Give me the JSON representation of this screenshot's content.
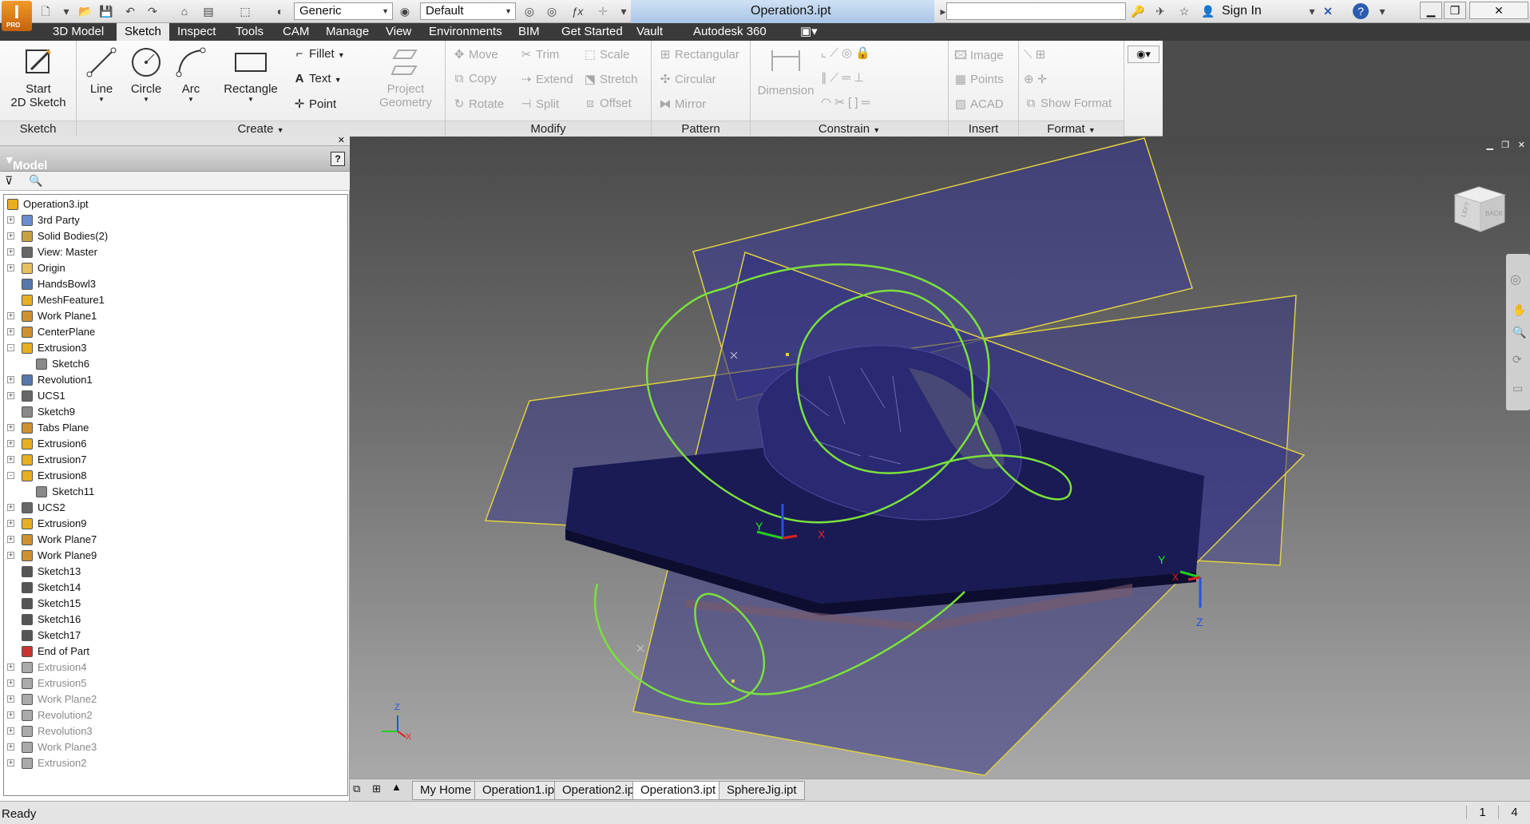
{
  "app": {
    "logo": "I",
    "edition": "PRO"
  },
  "titlebar": {
    "material_combo": "Generic",
    "appearance_combo": "Default",
    "document_title": "Operation3.ipt",
    "sign_in": "Sign In"
  },
  "tabs": [
    "3D Model",
    "Sketch",
    "Inspect",
    "Tools",
    "CAM",
    "Manage",
    "View",
    "Environments",
    "BIM",
    "Get Started",
    "Vault",
    "Autodesk 360"
  ],
  "active_tab": "Sketch",
  "ribbon": {
    "sketch_panel": {
      "name": "Sketch",
      "start": "Start",
      "start2": "2D Sketch"
    },
    "create_panel": {
      "name": "Create",
      "line": "Line",
      "circle": "Circle",
      "arc": "Arc",
      "rectangle": "Rectangle",
      "fillet": "Fillet",
      "text": "Text",
      "point": "Point",
      "project": "Project",
      "geometry": "Geometry"
    },
    "modify_panel": {
      "name": "Modify",
      "move": "Move",
      "trim": "Trim",
      "scale": "Scale",
      "copy": "Copy",
      "extend": "Extend",
      "stretch": "Stretch",
      "rotate": "Rotate",
      "split": "Split",
      "offset": "Offset"
    },
    "pattern_panel": {
      "name": "Pattern",
      "rectangular": "Rectangular",
      "circular": "Circular",
      "mirror": "Mirror"
    },
    "constrain_panel": {
      "name": "Constrain",
      "dimension": "Dimension"
    },
    "insert_panel": {
      "name": "Insert",
      "image": "Image",
      "points": "Points",
      "acad": "ACAD"
    },
    "format_panel": {
      "name": "Format",
      "show_format": "Show Format"
    }
  },
  "browser": {
    "title": "Model",
    "nodes": [
      {
        "label": "Operation3.ipt",
        "indent": 0,
        "expander": "",
        "icon": "part-icon",
        "color": "#e8b020",
        "dim": false
      },
      {
        "label": "3rd Party",
        "indent": 1,
        "expander": "+",
        "icon": "third-party-icon",
        "color": "#6a8fd0",
        "dim": false
      },
      {
        "label": "Solid Bodies(2)",
        "indent": 1,
        "expander": "+",
        "icon": "solid-bodies-icon",
        "color": "#c8a040",
        "dim": false
      },
      {
        "label": "View: Master",
        "indent": 1,
        "expander": "+",
        "icon": "view-icon",
        "color": "#666666",
        "dim": false
      },
      {
        "label": "Origin",
        "indent": 1,
        "expander": "+",
        "icon": "folder-icon",
        "color": "#e8c060",
        "dim": false
      },
      {
        "label": "HandsBowl3",
        "indent": 1,
        "expander": "",
        "icon": "mesh-icon",
        "color": "#5577aa",
        "dim": false
      },
      {
        "label": "MeshFeature1",
        "indent": 1,
        "expander": "",
        "icon": "mesh-feature-icon",
        "color": "#e8b020",
        "dim": false
      },
      {
        "label": "Work Plane1",
        "indent": 1,
        "expander": "+",
        "icon": "work-plane-icon",
        "color": "#d09030",
        "dim": false
      },
      {
        "label": "CenterPlane",
        "indent": 1,
        "expander": "+",
        "icon": "work-plane-icon",
        "color": "#d09030",
        "dim": false
      },
      {
        "label": "Extrusion3",
        "indent": 1,
        "expander": "-",
        "icon": "extrusion-icon",
        "color": "#e8b020",
        "dim": false
      },
      {
        "label": "Sketch6",
        "indent": 2,
        "expander": "",
        "icon": "sketch-icon",
        "color": "#888888",
        "dim": false
      },
      {
        "label": "Revolution1",
        "indent": 1,
        "expander": "+",
        "icon": "revolution-icon",
        "color": "#5577aa",
        "dim": false
      },
      {
        "label": "UCS1",
        "indent": 1,
        "expander": "+",
        "icon": "ucs-icon",
        "color": "#666666",
        "dim": false
      },
      {
        "label": "Sketch9",
        "indent": 1,
        "expander": "",
        "icon": "sketch-icon",
        "color": "#888888",
        "dim": false
      },
      {
        "label": "Tabs Plane",
        "indent": 1,
        "expander": "+",
        "icon": "work-plane-icon",
        "color": "#d09030",
        "dim": false
      },
      {
        "label": "Extrusion6",
        "indent": 1,
        "expander": "+",
        "icon": "extrusion-icon",
        "color": "#e8b020",
        "dim": false
      },
      {
        "label": "Extrusion7",
        "indent": 1,
        "expander": "+",
        "icon": "extrusion-icon",
        "color": "#e8b020",
        "dim": false
      },
      {
        "label": "Extrusion8",
        "indent": 1,
        "expander": "-",
        "icon": "extrusion-icon",
        "color": "#e8b020",
        "dim": false
      },
      {
        "label": "Sketch11",
        "indent": 2,
        "expander": "",
        "icon": "sketch-icon",
        "color": "#888888",
        "dim": false
      },
      {
        "label": "UCS2",
        "indent": 1,
        "expander": "+",
        "icon": "ucs-icon",
        "color": "#666666",
        "dim": false
      },
      {
        "label": "Extrusion9",
        "indent": 1,
        "expander": "+",
        "icon": "extrusion-icon",
        "color": "#e8b020",
        "dim": false
      },
      {
        "label": "Work Plane7",
        "indent": 1,
        "expander": "+",
        "icon": "work-plane-icon",
        "color": "#d09030",
        "dim": false
      },
      {
        "label": "Work Plane9",
        "indent": 1,
        "expander": "+",
        "icon": "work-plane-icon",
        "color": "#d09030",
        "dim": false
      },
      {
        "label": "Sketch13",
        "indent": 1,
        "expander": "",
        "icon": "sketch-icon",
        "color": "#555555",
        "dim": false
      },
      {
        "label": "Sketch14",
        "indent": 1,
        "expander": "",
        "icon": "sketch-icon",
        "color": "#555555",
        "dim": false
      },
      {
        "label": "Sketch15",
        "indent": 1,
        "expander": "",
        "icon": "sketch-icon",
        "color": "#555555",
        "dim": false
      },
      {
        "label": "Sketch16",
        "indent": 1,
        "expander": "",
        "icon": "sketch-icon",
        "color": "#555555",
        "dim": false
      },
      {
        "label": "Sketch17",
        "indent": 1,
        "expander": "",
        "icon": "sketch-icon",
        "color": "#555555",
        "dim": false
      },
      {
        "label": "End of Part",
        "indent": 1,
        "expander": "",
        "icon": "end-of-part-icon",
        "color": "#cc3333",
        "dim": false
      },
      {
        "label": "Extrusion4",
        "indent": 1,
        "expander": "+",
        "icon": "extrusion-icon",
        "color": "#aaaaaa",
        "dim": true
      },
      {
        "label": "Extrusion5",
        "indent": 1,
        "expander": "+",
        "icon": "extrusion-icon",
        "color": "#aaaaaa",
        "dim": true
      },
      {
        "label": "Work Plane2",
        "indent": 1,
        "expander": "+",
        "icon": "work-plane-icon",
        "color": "#aaaaaa",
        "dim": true
      },
      {
        "label": "Revolution2",
        "indent": 1,
        "expander": "+",
        "icon": "revolution-icon",
        "color": "#aaaaaa",
        "dim": true
      },
      {
        "label": "Revolution3",
        "indent": 1,
        "expander": "+",
        "icon": "revolution-icon",
        "color": "#aaaaaa",
        "dim": true
      },
      {
        "label": "Work Plane3",
        "indent": 1,
        "expander": "+",
        "icon": "work-plane-icon",
        "color": "#aaaaaa",
        "dim": true
      },
      {
        "label": "Extrusion2",
        "indent": 1,
        "expander": "+",
        "icon": "extrusion-icon",
        "color": "#aaaaaa",
        "dim": true
      }
    ]
  },
  "viewport": {
    "axis_labels": {
      "x": "X",
      "y": "Y",
      "z": "Z"
    },
    "viewcube_faces": [
      "LEFT",
      "BACK"
    ]
  },
  "doc_tabs": [
    "My Home",
    "Operation1.ipt",
    "Operation2.ipt",
    "Operation3.ipt",
    "SphereJig.ipt"
  ],
  "active_doc_tab": "Operation3.ipt",
  "status": {
    "text": "Ready",
    "count1": "1",
    "count2": "4"
  },
  "colors": {
    "accent": "#1e5fb4",
    "sketch_green": "#7be13c",
    "plane_yellow": "#e0d040",
    "plane_fill": "#3a3a9a"
  }
}
